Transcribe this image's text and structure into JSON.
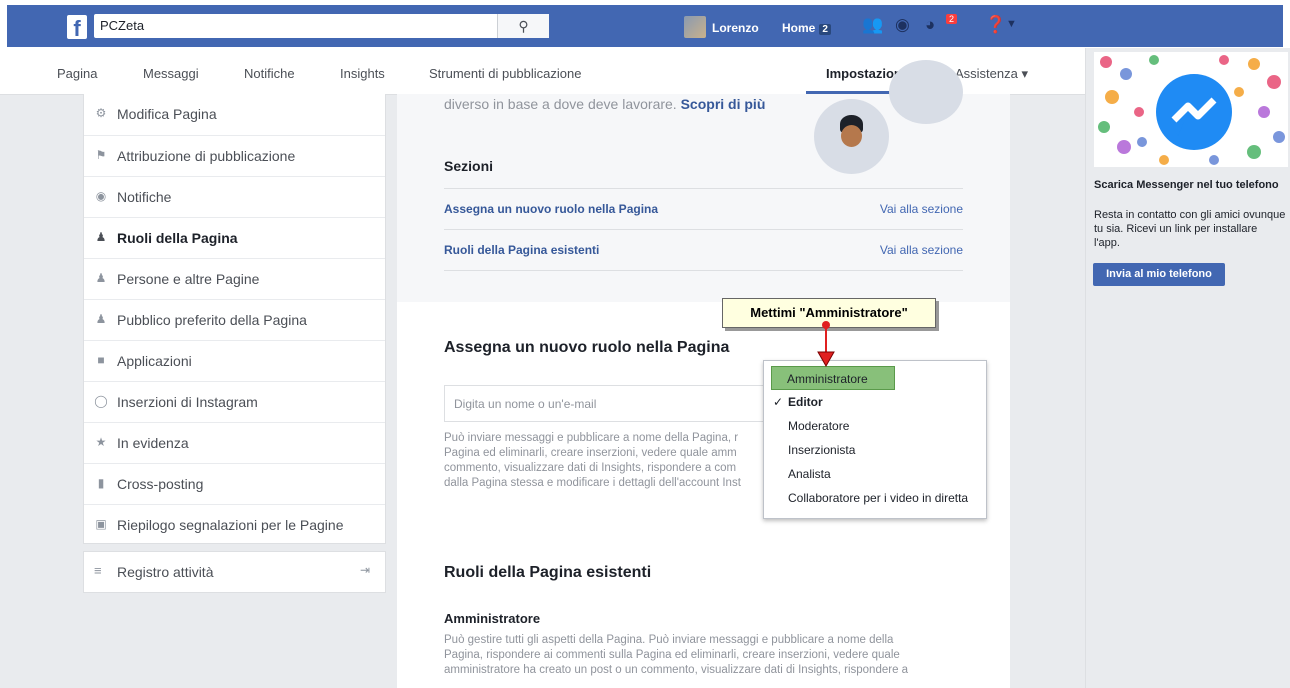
{
  "topbar": {
    "search_value": "PCZeta",
    "user_name": "Lorenzo",
    "home_label": "Home",
    "home_count": "2",
    "notif_count": "2"
  },
  "page_nav": [
    "Pagina",
    "Messaggi",
    "Notifiche",
    "Insights",
    "Strumenti di pubblicazione",
    "Impostazioni",
    "Assistenza ▾"
  ],
  "sidebar": {
    "items": [
      {
        "label": "Modifica Pagina",
        "icon": "gear-icon"
      },
      {
        "label": "Attribuzione di pubblicazione",
        "icon": "flag-icon"
      },
      {
        "label": "Notifiche",
        "icon": "globe-icon"
      },
      {
        "label": "Ruoli della Pagina",
        "icon": "person-icon"
      },
      {
        "label": "Persone e altre Pagine",
        "icon": "people-icon"
      },
      {
        "label": "Pubblico preferito della Pagina",
        "icon": "people-icon"
      },
      {
        "label": "Applicazioni",
        "icon": "cube-icon"
      },
      {
        "label": "Inserzioni di Instagram",
        "icon": "instagram-icon"
      },
      {
        "label": "In evidenza",
        "icon": "star-icon"
      },
      {
        "label": "Cross-posting",
        "icon": "video-icon"
      },
      {
        "label": "Riepilogo segnalazioni per le Pagine",
        "icon": "facebook-icon"
      }
    ],
    "registro": "Registro attività"
  },
  "main": {
    "intro_text": "diverso in base a dove deve lavorare.",
    "intro_link": "Scopri di più",
    "sezioni_title": "Sezioni",
    "sections": [
      {
        "label": "Assegna un nuovo ruolo nella Pagina",
        "action": "Vai alla sezione"
      },
      {
        "label": "Ruoli della Pagina esistenti",
        "action": "Vai alla sezione"
      }
    ],
    "assign_title": "Assegna un nuovo ruolo nella Pagina",
    "input_placeholder": "Digita un nome o un'e-mail",
    "assign_desc": [
      "Può inviare messaggi e pubblicare a nome della Pagina, r",
      "Pagina ed eliminarli, creare inserzioni, vedere quale amm",
      "commento, visualizzare dati di Insights, rispondere a com",
      "dalla Pagina stessa e modificare i dettagli dell'account Inst"
    ],
    "existing_title": "Ruoli della Pagina esistenti",
    "admin_title": "Amministratore",
    "admin_desc": [
      "Può gestire tutti gli aspetti della Pagina. Può inviare messaggi e pubblicare a nome della",
      "Pagina, rispondere ai commenti sulla Pagina ed eliminarli, creare inserzioni, vedere quale",
      "amministratore ha creato un post o un commento, visualizzare dati di Insights, rispondere a"
    ]
  },
  "dropdown": {
    "items": [
      "Amministratore",
      "Editor",
      "Moderatore",
      "Inserzionista",
      "Analista",
      "Collaboratore per i video in diretta"
    ],
    "checked": "Editor"
  },
  "callout": "Mettimi \"Amministratore\"",
  "ad": {
    "title": "Scarica Messenger nel tuo telefono",
    "body": "Resta in contatto con gli amici ovunque tu sia. Ricevi un link per installare l'app.",
    "button": "Invia al mio telefono"
  }
}
